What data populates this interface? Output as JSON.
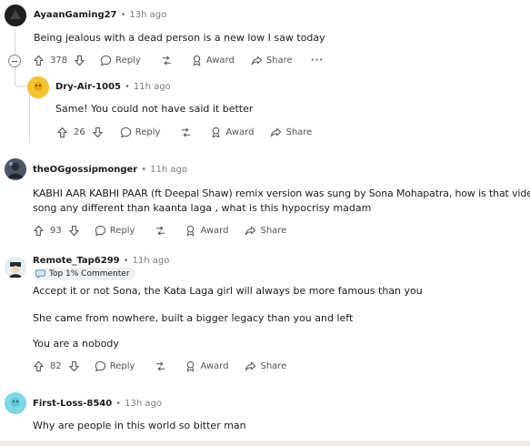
{
  "comments": [
    {
      "username": "AyaanGaming27",
      "time": "13h ago",
      "text": "Being jealous with a dead person is a new low I saw today",
      "votes": "378",
      "reply": "Reply",
      "award": "Award",
      "share": "Share"
    },
    {
      "username": "Dry-Air-1005",
      "time": "11h ago",
      "text": "Same! You could not have said it better",
      "votes": "26",
      "reply": "Reply",
      "award": "Award",
      "share": "Share"
    },
    {
      "username": "theOGgossipmonger",
      "time": "11h ago",
      "text_lines": [
        "KABHI AAR KABHI PAAR (ft Deepal Shaw) remix version was sung by Sona Mohapatra, how is that video/",
        "song any different than kaanta laga , what is this hypocrisy madam"
      ],
      "votes": "93",
      "reply": "Reply",
      "award": "Award",
      "share": "Share"
    },
    {
      "username": "Remote_Tap6299",
      "time": "11h ago",
      "flair": "Top 1% Commenter",
      "paragraphs": [
        "Accept it or not Sona, the Kata Laga girl will always be more famous than you",
        "She came from nowhere, built a bigger legacy than you and left",
        "You are a nobody"
      ],
      "votes": "82",
      "reply": "Reply",
      "award": "Award",
      "share": "Share"
    },
    {
      "username": "First-Loss-8540",
      "time": "13h ago",
      "text": "Why are people in this world so bitter man"
    }
  ],
  "separator": "•",
  "more": "···",
  "colors": {
    "meta_gray": "#7c7c7c",
    "thread_line": "#d7d7d7",
    "dry_air_avatar": "#f4c430",
    "first_loss_avatar": "#7fd8e6"
  }
}
